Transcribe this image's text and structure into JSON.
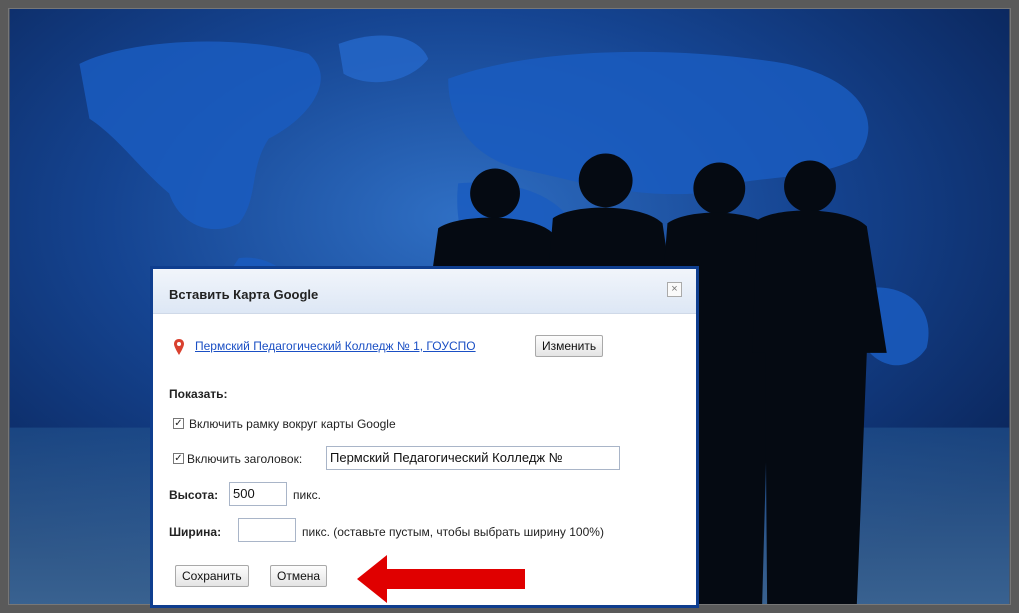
{
  "dialog": {
    "title": "Вставить Карта Google",
    "close_icon": "close-icon",
    "location": {
      "name": "Пермский Педагогический Колледж № 1, ГОУСПО",
      "change_label": "Изменить"
    },
    "show_label": "Показать:",
    "frame_checkbox": {
      "label": "Включить рамку вокруг карты Google",
      "checked": true
    },
    "title_checkbox": {
      "label": "Включить заголовок:",
      "checked": true,
      "value": "Пермский Педагогический Колледж №"
    },
    "height": {
      "label": "Высота:",
      "value": "500",
      "unit": "пикс."
    },
    "width": {
      "label": "Ширина:",
      "value": "",
      "unit": "пикс. (оставьте пустым, чтобы выбрать ширину 100%)"
    },
    "save_label": "Сохранить",
    "cancel_label": "Отмена"
  },
  "colors": {
    "dialog_border": "#0f3e8f",
    "link": "#1a4fc4",
    "arrow": "#e00000",
    "background": "#0c2d6b"
  }
}
